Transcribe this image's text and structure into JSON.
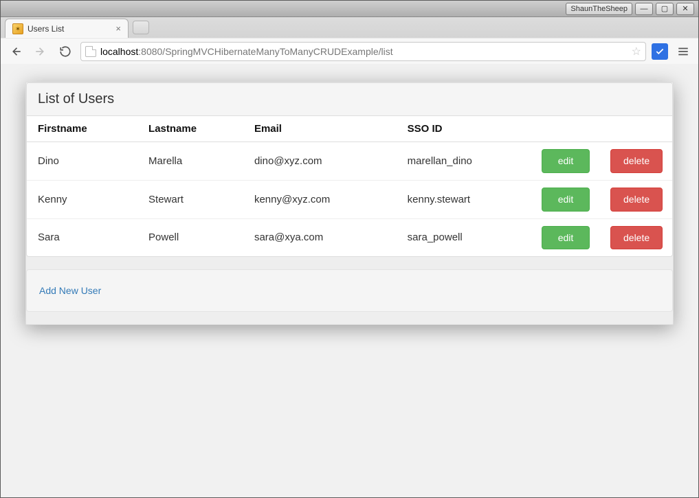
{
  "os": {
    "task_button": "ShaunTheSheep",
    "min": "—",
    "max": "▢",
    "close": "✕"
  },
  "browser": {
    "tab_title": "Users List",
    "url_host": "localhost",
    "url_port_path": ":8080/SpringMVCHibernateManyToManyCRUDExample/list"
  },
  "page": {
    "heading": "List of Users",
    "columns": {
      "firstname": "Firstname",
      "lastname": "Lastname",
      "email": "Email",
      "sso": "SSO ID",
      "edit": "",
      "delete": ""
    },
    "buttons": {
      "edit": "edit",
      "delete": "delete"
    },
    "rows": [
      {
        "firstname": "Dino",
        "lastname": "Marella",
        "email": "dino@xyz.com",
        "sso": "marellan_dino"
      },
      {
        "firstname": "Kenny",
        "lastname": "Stewart",
        "email": "kenny@xyz.com",
        "sso": "kenny.stewart"
      },
      {
        "firstname": "Sara",
        "lastname": "Powell",
        "email": "sara@xya.com",
        "sso": "sara_powell"
      }
    ],
    "add_link": "Add New User"
  }
}
